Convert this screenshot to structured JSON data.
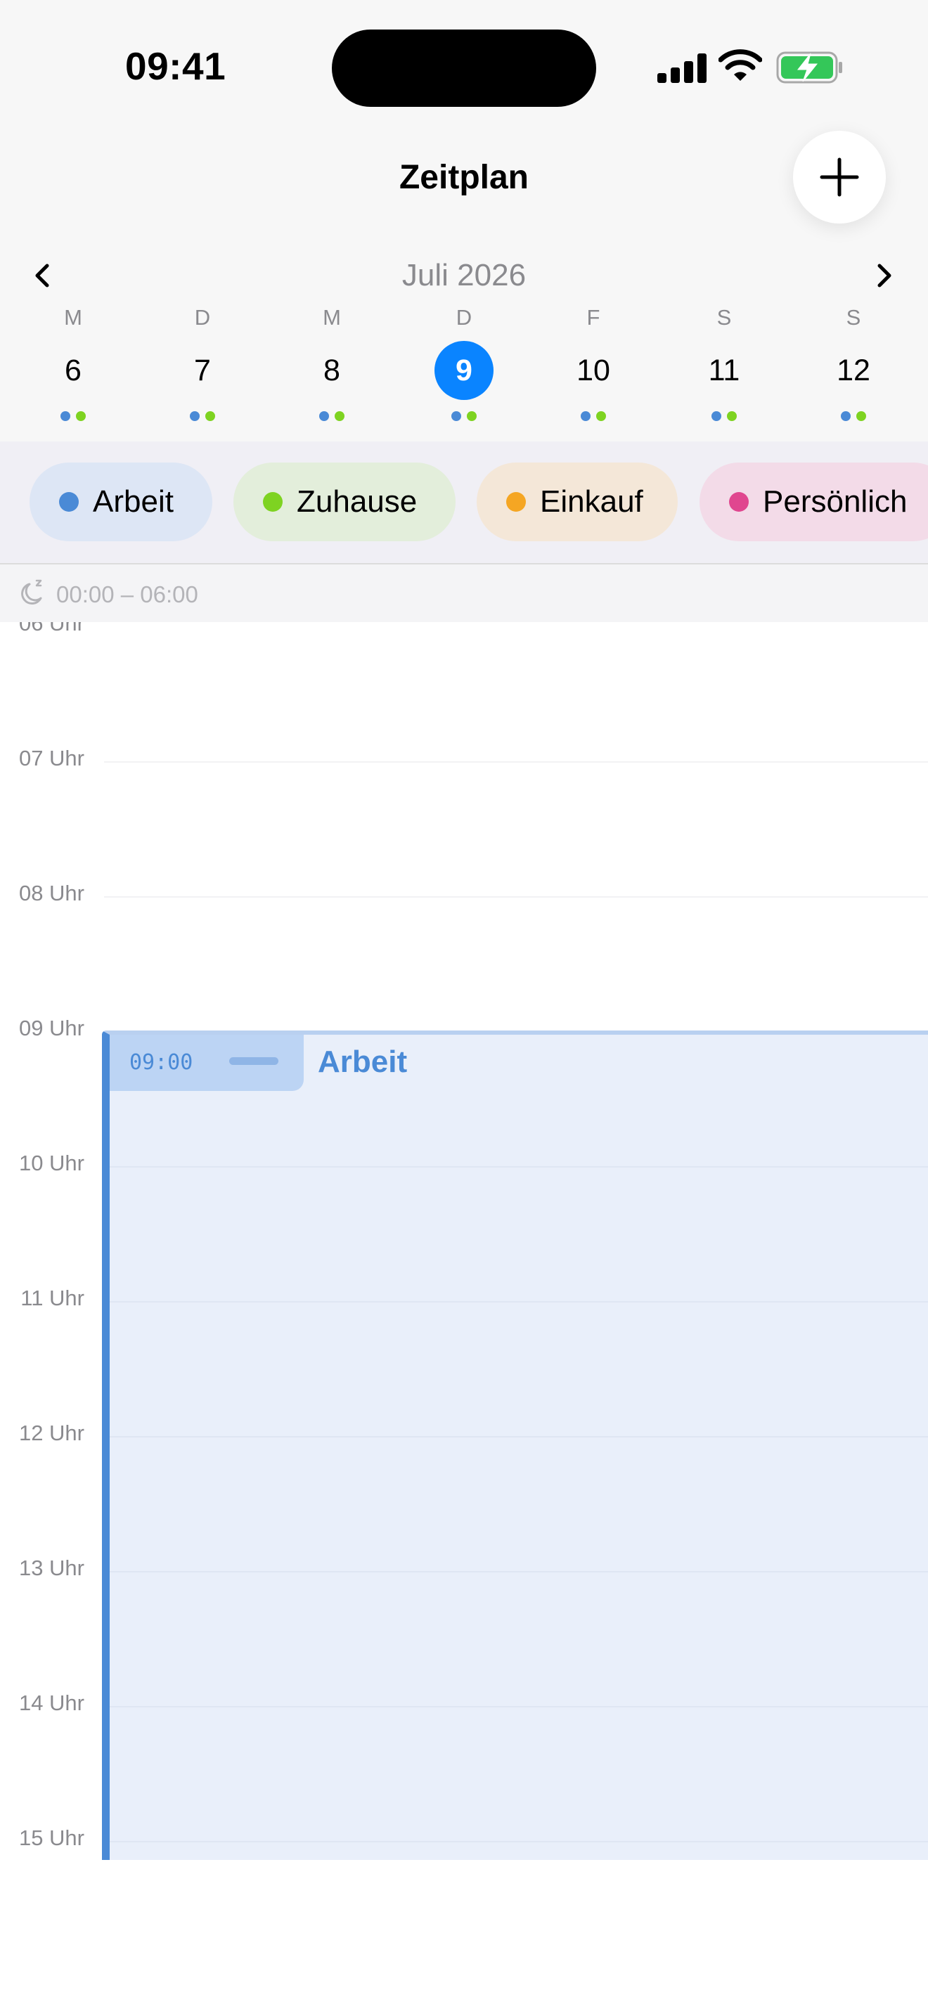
{
  "status_bar": {
    "time": "09:41"
  },
  "header": {
    "title": "Zeitplan"
  },
  "calendar": {
    "month": "Juli 2026",
    "days": [
      {
        "dow": "M",
        "num": "6"
      },
      {
        "dow": "D",
        "num": "7"
      },
      {
        "dow": "M",
        "num": "8"
      },
      {
        "dow": "D",
        "num": "9",
        "selected": true
      },
      {
        "dow": "F",
        "num": "10"
      },
      {
        "dow": "S",
        "num": "11"
      },
      {
        "dow": "S",
        "num": "12"
      }
    ]
  },
  "filters": [
    {
      "label": "Arbeit",
      "color": "#4a8ad6",
      "bg": "#dde6f5"
    },
    {
      "label": "Zuhause",
      "color": "#7ed321",
      "bg": "#e3eedb"
    },
    {
      "label": "Einkauf",
      "color": "#f5a623",
      "bg": "#f4e7d8"
    },
    {
      "label": "Persönlich",
      "color": "#e0468f",
      "bg": "#f3dbe8"
    }
  ],
  "night": {
    "label": "00:00 – 06:00"
  },
  "hours": [
    "06 Uhr",
    "07 Uhr",
    "08 Uhr",
    "09 Uhr",
    "10 Uhr",
    "11 Uhr",
    "12 Uhr",
    "13 Uhr",
    "14 Uhr",
    "15 Uhr"
  ],
  "event": {
    "time": "09:00",
    "title": "Arbeit",
    "color": "#4a8ad6"
  },
  "colors": {
    "accent": "#0a84ff",
    "work": "#4a8ad6",
    "home": "#7ed321"
  }
}
